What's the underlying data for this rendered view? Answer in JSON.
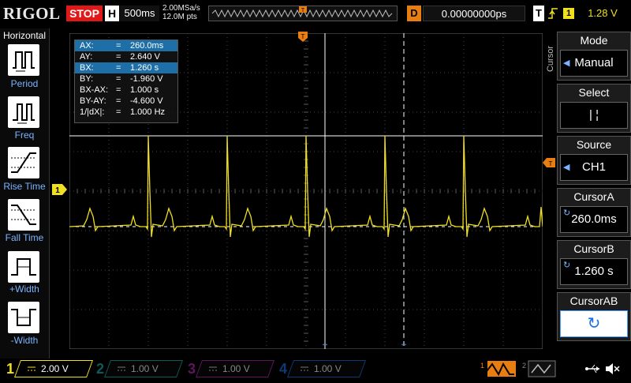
{
  "topbar": {
    "brand": "RIGOL",
    "status": "STOP",
    "h_label": "H",
    "timebase": "500ms",
    "sample_rate": "2.00MSa/s",
    "memory_depth": "12.0M pts",
    "delay_label": "D",
    "delay_value": "0.00000000ps",
    "trigger_label": "T",
    "trigger_source": "1",
    "trigger_level": "1.28 V"
  },
  "cursor_readout": {
    "rows": [
      {
        "label": "AX:",
        "value": "260.0ms"
      },
      {
        "label": "AY:",
        "value": "2.640 V"
      },
      {
        "label": "BX:",
        "value": "1.260 s"
      },
      {
        "label": "BY:",
        "value": "-1.960 V"
      },
      {
        "label": "BX-AX:",
        "value": "1.000 s"
      },
      {
        "label": "BY-AY:",
        "value": "-4.600 V"
      },
      {
        "label": "1/|dX|:",
        "value": "1.000 Hz"
      }
    ],
    "eq": "="
  },
  "left_panel": {
    "title": "Horizontal",
    "items": [
      "Period",
      "Freq",
      "Rise Time",
      "Fall Time",
      "+Width",
      "-Width"
    ]
  },
  "right_panel": {
    "side_label": "Cursor",
    "menus": [
      {
        "title": "Mode",
        "value": "Manual"
      },
      {
        "title": "Select",
        "value": "|  ¦"
      },
      {
        "title": "Source",
        "value": "CH1"
      },
      {
        "title": "CursorA",
        "value": "260.0ms"
      },
      {
        "title": "CursorB",
        "value": "1.260 s"
      },
      {
        "title": "CursorAB",
        "value": ""
      }
    ]
  },
  "channels": [
    {
      "num": "1",
      "scale": "2.00 V",
      "color": "#f0e020"
    },
    {
      "num": "2",
      "scale": "1.00 V",
      "color": "#20c8c8"
    },
    {
      "num": "3",
      "scale": "1.00 V",
      "color": "#d030d0"
    },
    {
      "num": "4",
      "scale": "1.00 V",
      "color": "#2080ff"
    }
  ],
  "markers": {
    "ch1_marker": "1",
    "trigger_marker": "T"
  },
  "colors": {
    "trace": "#f0e020",
    "accent": "#78b4ff",
    "stop": "#e01818",
    "trigger": "#e87e10"
  }
}
